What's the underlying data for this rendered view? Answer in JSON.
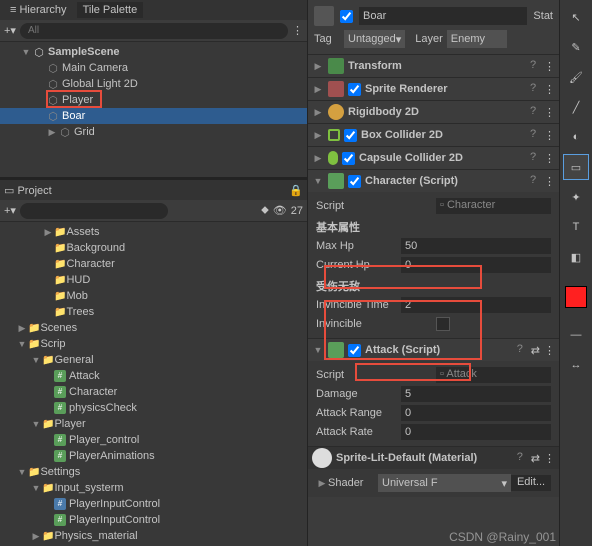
{
  "hierarchy": {
    "title": "Hierarchy",
    "tab2": "Tile Palette",
    "search_placeholder": "All",
    "scene": "SampleScene",
    "items": [
      "Main Camera",
      "Global Light 2D",
      "Player",
      "Boar",
      "Grid"
    ]
  },
  "project": {
    "title": "Project",
    "count": "27",
    "folders": {
      "assets": "Assets",
      "background": "Background",
      "character": "Character",
      "hud": "HUD",
      "mob": "Mob",
      "trees": "Trees",
      "scenes": "Scenes",
      "scrip": "Scrip",
      "general": "General",
      "attack": "Attack",
      "character2": "Character",
      "physicscheck": "physicsCheck",
      "player": "Player",
      "playercontrol": "Player_control",
      "playeranim": "PlayerAnimations",
      "settings": "Settings",
      "inputsys": "Input_systerm",
      "pinput": "PlayerInputControl",
      "pinput2": "PlayerInputControl",
      "physmat": "Physics_material"
    }
  },
  "inspector": {
    "name": "Boar",
    "static": "Stat",
    "tag_label": "Tag",
    "tag_value": "Untagged",
    "layer_label": "Layer",
    "layer_value": "Enemy",
    "components": {
      "transform": "Transform",
      "sprite": "Sprite Renderer",
      "rb": "Rigidbody 2D",
      "box": "Box Collider 2D",
      "capsule": "Capsule Collider 2D",
      "character": "Character (Script)",
      "attack": "Attack (Script)"
    },
    "script_label": "Script",
    "script_char": "Character",
    "script_atk": "Attack",
    "section1": "基本属性",
    "maxhp_label": "Max Hp",
    "maxhp_value": "50",
    "curhp_label": "Current Hp",
    "curhp_value": "0",
    "section2": "受伤无敌",
    "invtime_label": "Invincible Time",
    "invtime_value": "2",
    "inv_label": "Invincible",
    "dmg_label": "Damage",
    "dmg_value": "5",
    "range_label": "Attack Range",
    "range_value": "0",
    "rate_label": "Attack Rate",
    "rate_value": "0",
    "material": "Sprite-Lit-Default (Material)",
    "shader_label": "Shader",
    "shader_value": "Universal F",
    "edit": "Edit..."
  },
  "watermark": "CSDN @Rainy_001"
}
